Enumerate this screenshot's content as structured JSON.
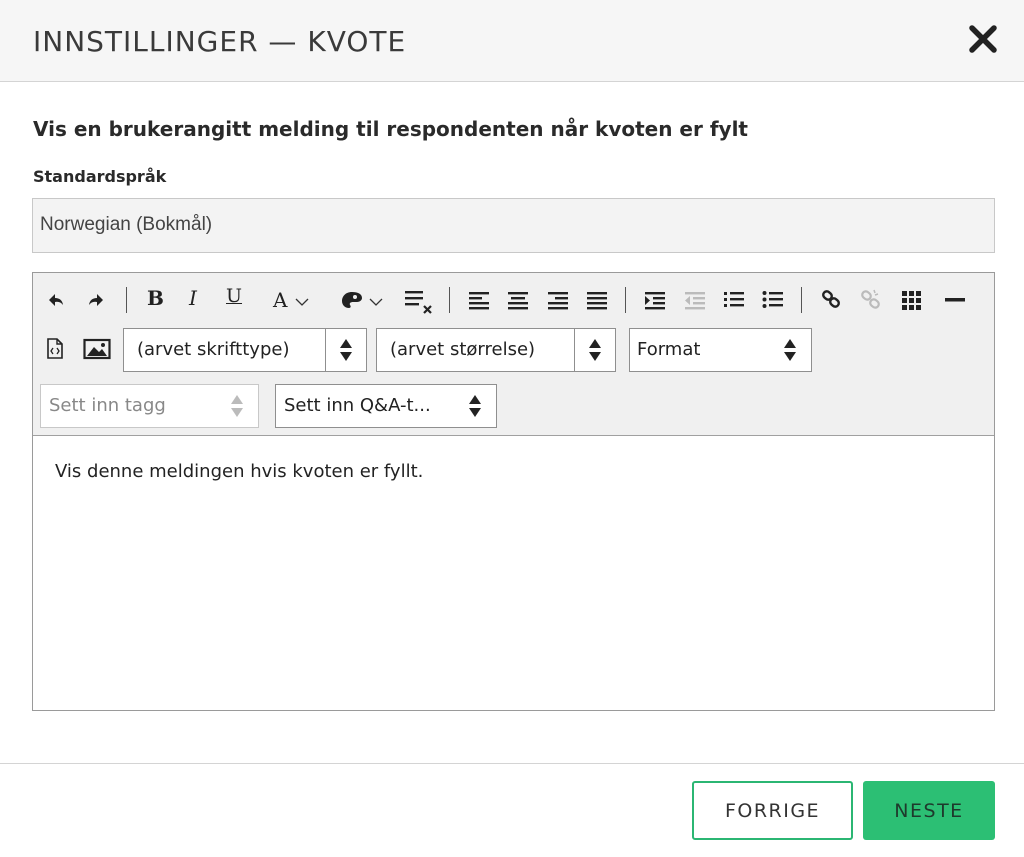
{
  "dialog": {
    "title": "INNSTILLINGER — KVOTE"
  },
  "main": {
    "heading": "Vis en brukerangitt melding til respondenten når kvoten er fylt",
    "language_label": "Standardspråk",
    "language_value": "Norwegian (Bokmål)"
  },
  "editor": {
    "toolbar": {
      "bold_label": "B",
      "italic_label": "I",
      "underline_label": "U",
      "font_color_label": "A",
      "font_family_value": "(arvet skrifttype)",
      "font_size_value": "(arvet størrelse)",
      "format_value": "Format",
      "insert_tag_placeholder": "Sett inn tagg",
      "insert_qa_value": "Sett inn Q&A-t..."
    },
    "content": "Vis denne meldingen hvis kvoten er fyllt."
  },
  "footer": {
    "prev_label": "FORRIGE",
    "next_label": "NESTE"
  },
  "colors": {
    "accent_green": "#2cbf74",
    "outline_green": "#2bb673"
  }
}
